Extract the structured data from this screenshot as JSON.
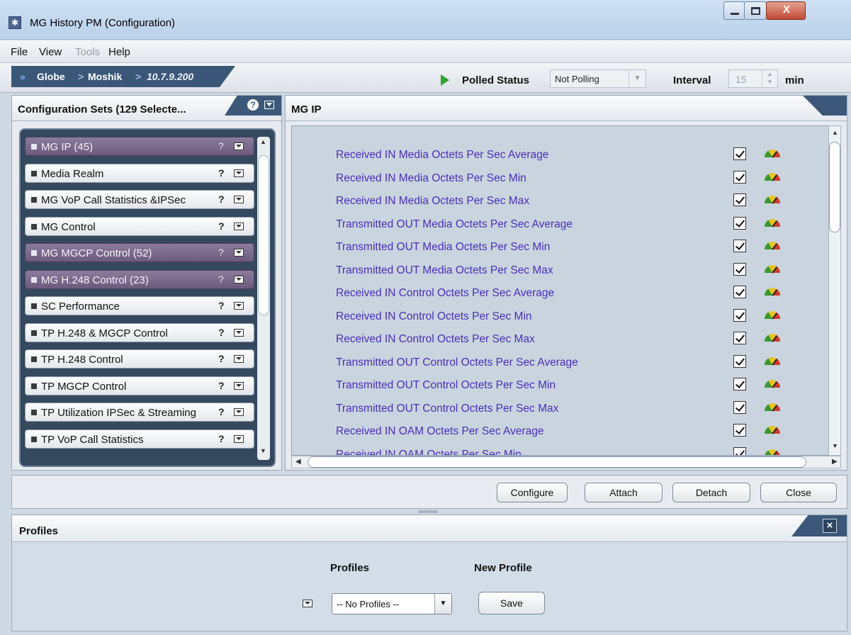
{
  "window": {
    "title": "MG History PM (Configuration)",
    "close_glyph": "X"
  },
  "menu": {
    "file": "File",
    "view": "View",
    "tools": "Tools",
    "help": "Help"
  },
  "breadcrumb": {
    "arrow": "»",
    "items": [
      "Globe",
      "Moshik",
      "10.7.9.200"
    ],
    "separator": ">"
  },
  "polling": {
    "status_label": "Polled Status",
    "status_value": "Not Polling",
    "interval_label": "Interval",
    "interval_value": "15",
    "interval_unit": "min"
  },
  "config_sets": {
    "title": "Configuration Sets (129 Selecte...",
    "help_glyph": "?",
    "items": [
      {
        "label": "MG IP  (45)",
        "help": "?",
        "selected": true
      },
      {
        "label": "Media Realm",
        "help": "?",
        "selected": false
      },
      {
        "label": "MG VoP Call Statistics &IPSec",
        "help": "?",
        "selected": false
      },
      {
        "label": "MG Control",
        "help": "?",
        "selected": false
      },
      {
        "label": "MG MGCP Control (52)",
        "help": "?",
        "selected": true
      },
      {
        "label": "MG H.248  Control (23)",
        "help": "?",
        "selected": true
      },
      {
        "label": "SC Performance",
        "help": "?",
        "selected": false
      },
      {
        "label": "TP H.248 & MGCP Control",
        "help": "?",
        "selected": false
      },
      {
        "label": "TP H.248  Control",
        "help": "?",
        "selected": false
      },
      {
        "label": "TP MGCP Control",
        "help": "?",
        "selected": false
      },
      {
        "label": "TP Utilization IPSec & Streaming",
        "help": "?",
        "selected": false
      },
      {
        "label": "TP VoP Call Statistics",
        "help": "?",
        "selected": false
      }
    ]
  },
  "metrics_panel": {
    "title": "MG IP",
    "rows": [
      {
        "label": "Received IN Media Octets Per Sec Average",
        "checked": true
      },
      {
        "label": "Received IN Media Octets Per Sec Min",
        "checked": true
      },
      {
        "label": "Received IN Media Octets Per Sec Max",
        "checked": true
      },
      {
        "label": "Transmitted OUT Media Octets Per Sec Average",
        "checked": true
      },
      {
        "label": "Transmitted OUT Media Octets Per Sec Min",
        "checked": true
      },
      {
        "label": "Transmitted OUT Media Octets Per Sec Max",
        "checked": true
      },
      {
        "label": "Received IN Control Octets Per Sec Average",
        "checked": true
      },
      {
        "label": "Received IN Control Octets Per Sec Min",
        "checked": true
      },
      {
        "label": "Received IN Control Octets Per Sec Max",
        "checked": true
      },
      {
        "label": "Transmitted OUT Control Octets Per Sec Average",
        "checked": true
      },
      {
        "label": "Transmitted OUT Control Octets Per Sec Min",
        "checked": true
      },
      {
        "label": "Transmitted OUT Control Octets Per Sec Max",
        "checked": true
      },
      {
        "label": "Received IN OAM Octets Per Sec Average",
        "checked": true
      },
      {
        "label": "Received IN OAM Octets Per Sec Min",
        "checked": true
      }
    ]
  },
  "actions": {
    "configure": "Configure",
    "attach": "Attach",
    "detach": "Detach",
    "close": "Close"
  },
  "profiles": {
    "title": "Profiles",
    "close_glyph": "×",
    "profiles_label": "Profiles",
    "new_profile_label": "New Profile",
    "selected_profile": "-- No Profiles --",
    "save_label": "Save"
  },
  "colors": {
    "metric_text": "#4a2fb7",
    "header_tab": "#3c5878",
    "selected_item": "#7a6a8c",
    "polling_play": "#2ea52e"
  },
  "icons": {
    "app": "gear-icon",
    "play": "play-icon",
    "gauge": "gauge-icon",
    "help": "help-icon",
    "menu": "dropdown-menu-icon"
  }
}
